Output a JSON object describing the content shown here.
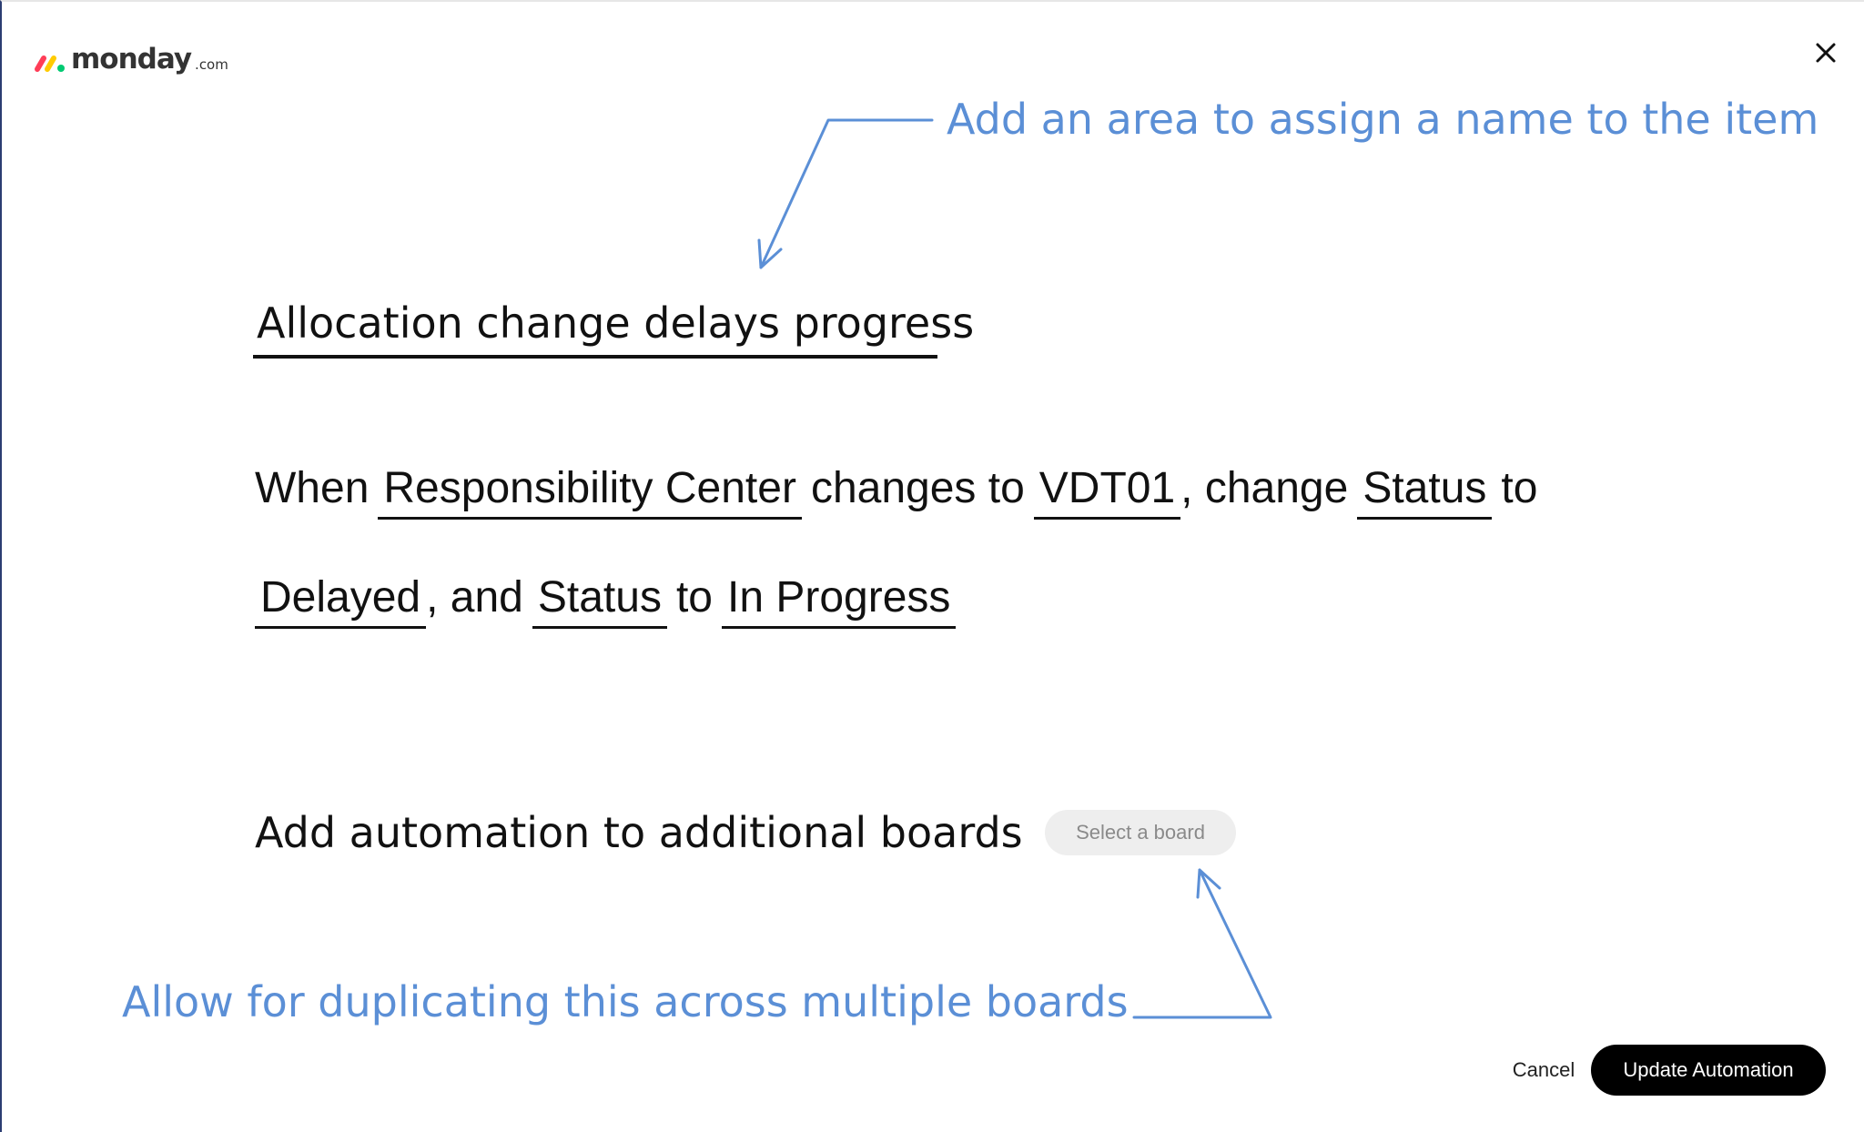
{
  "header": {
    "logo_word": "monday",
    "logo_suffix": ".com",
    "close_icon": "close-icon",
    "brand_colors": [
      "#ff3d57",
      "#ffcb00",
      "#00ca72"
    ]
  },
  "annotations": {
    "top": "Add an area to assign a name to the item",
    "bottom": "Allow for duplicating this across multiple boards",
    "color": "#5b8fd6"
  },
  "automation": {
    "name": "Allocation change delays progress",
    "when": "When",
    "trigger_column": "Responsibility Center",
    "changes_to": "changes to",
    "trigger_value": "VDT01",
    "comma_change": ", change",
    "action_column_1": "Status",
    "to_1": "to",
    "action_value_1": "Delayed",
    "comma_and": ", and",
    "action_column_2": "Status",
    "to_2": "to",
    "action_value_2": "In Progress"
  },
  "additional_boards": {
    "label": "Add automation to additional boards",
    "select_placeholder": "Select a board"
  },
  "footer": {
    "cancel_label": "Cancel",
    "update_label": "Update Automation"
  }
}
